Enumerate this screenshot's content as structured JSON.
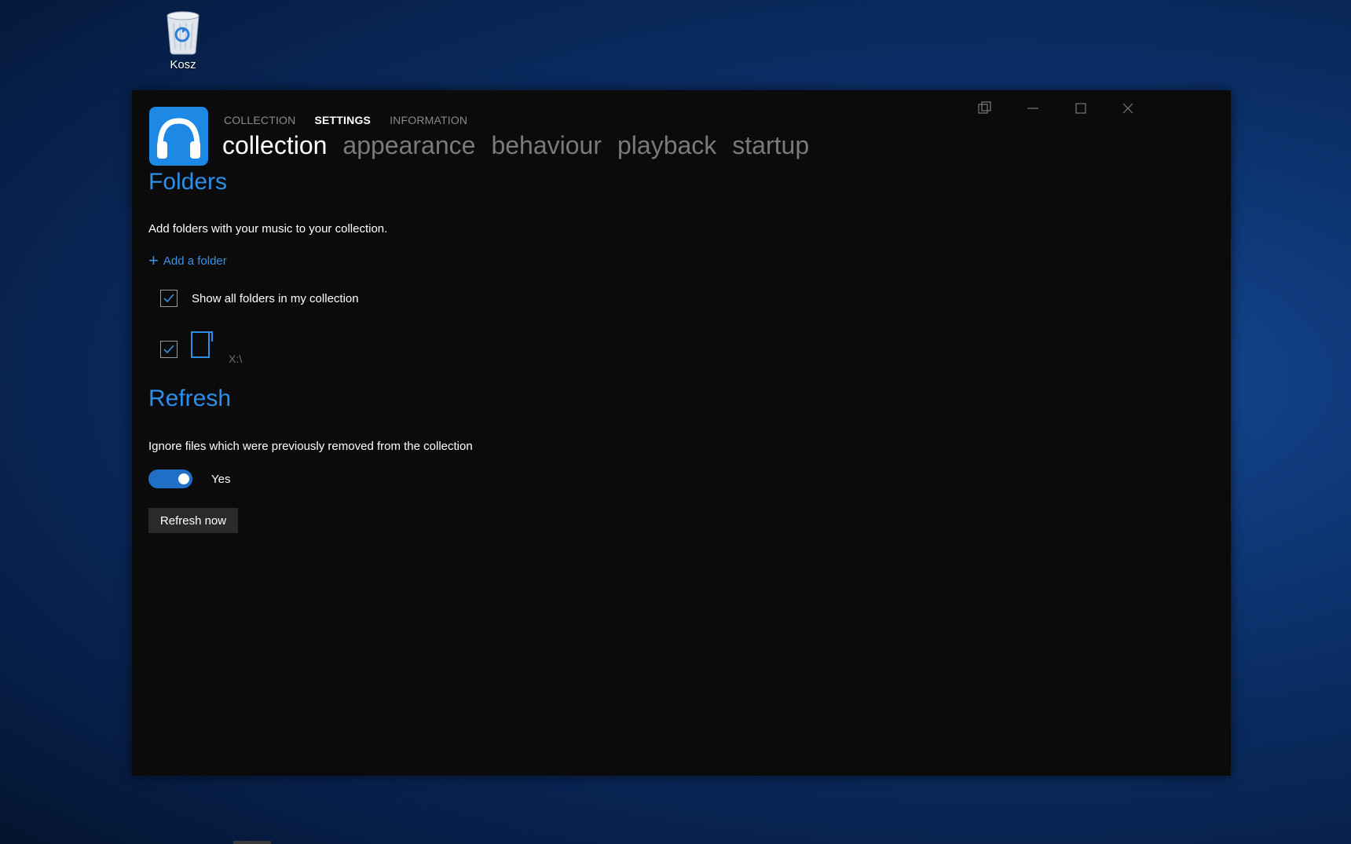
{
  "desktop": {
    "recycle_bin_label": "Kosz"
  },
  "window": {
    "top_nav": [
      {
        "label": "COLLECTION",
        "active": false
      },
      {
        "label": "SETTINGS",
        "active": true
      },
      {
        "label": "INFORMATION",
        "active": false
      }
    ],
    "sub_nav": [
      {
        "label": "collection",
        "active": true
      },
      {
        "label": "appearance",
        "active": false
      },
      {
        "label": "behaviour",
        "active": false
      },
      {
        "label": "playback",
        "active": false
      },
      {
        "label": "startup",
        "active": false
      }
    ],
    "controls": [
      "compact-mode-icon",
      "minimize-icon",
      "maximize-icon",
      "close-icon"
    ]
  },
  "folders": {
    "title": "Folders",
    "description": "Add folders with your music to your collection.",
    "add_folder_label": "Add a folder",
    "show_all_label": "Show all folders in my collection",
    "show_all_checked": true,
    "items": [
      {
        "path": "X:\\",
        "checked": true
      }
    ]
  },
  "refresh": {
    "title": "Refresh",
    "description": "Ignore files which were previously removed from the collection",
    "toggle_label": "Yes",
    "toggle_on": true,
    "button_label": "Refresh now"
  },
  "colors": {
    "accent": "#2c8ee8",
    "window_bg": "#0b0b0b"
  }
}
